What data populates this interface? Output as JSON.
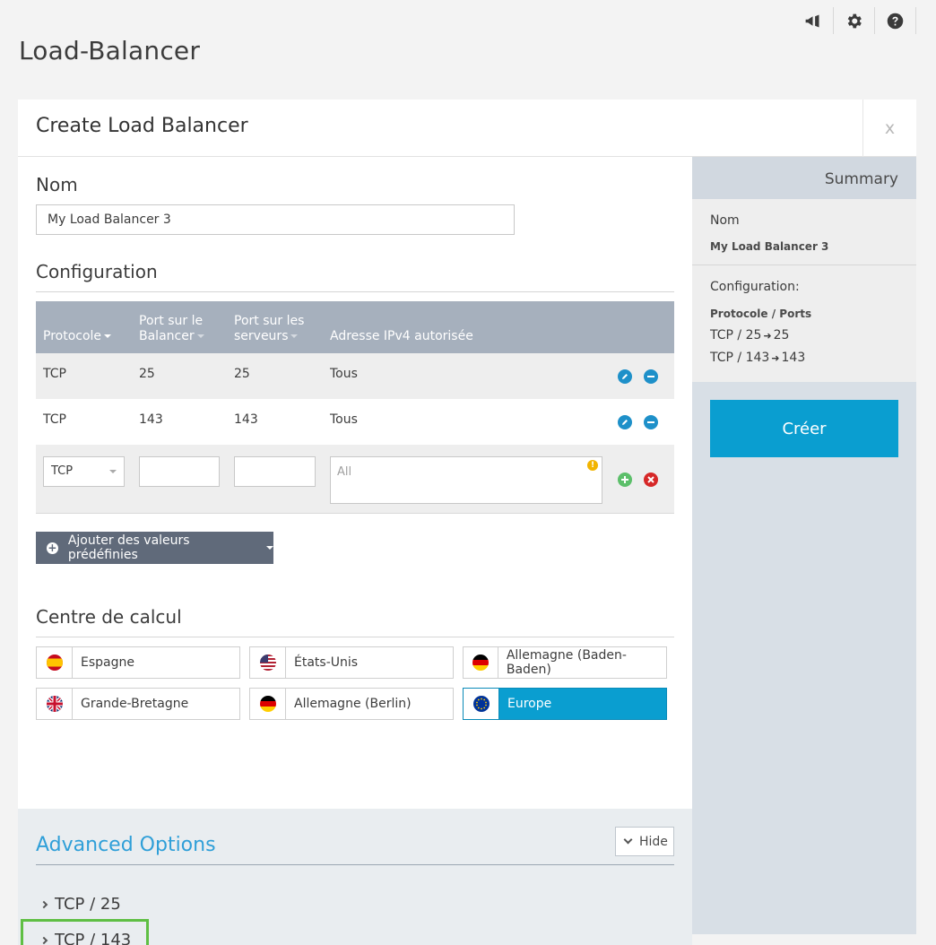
{
  "page": {
    "title": "Load-Balancer"
  },
  "dialog": {
    "title": "Create Load Balancer",
    "close_label": "x"
  },
  "nom": {
    "heading": "Nom",
    "value": "My Load Balancer 3"
  },
  "configuration": {
    "heading": "Configuration",
    "headers": {
      "protocol": "Protocole",
      "balancer_port_1": "Port sur le",
      "balancer_port_2": "Balancer",
      "server_port_1": "Port sur les",
      "server_port_2": "serveurs",
      "ip": "Adresse IPv4 autorisée"
    },
    "rows": [
      {
        "protocol": "TCP",
        "balancer_port": "25",
        "server_port": "25",
        "ip": "Tous"
      },
      {
        "protocol": "TCP",
        "balancer_port": "143",
        "server_port": "143",
        "ip": "Tous"
      }
    ],
    "new_row": {
      "protocol": "TCP",
      "ip_placeholder": "All"
    },
    "predef_label": "Ajouter des valeurs prédéfinies"
  },
  "datacenter": {
    "heading": "Centre de calcul",
    "options": [
      {
        "label": "Espagne",
        "flag": "es",
        "active": false
      },
      {
        "label": "États-Unis",
        "flag": "us",
        "active": false
      },
      {
        "label": "Allemagne (Baden-Baden)",
        "flag": "de",
        "active": false
      },
      {
        "label": "Grande-Bretagne",
        "flag": "gb",
        "active": false
      },
      {
        "label": "Allemagne (Berlin)",
        "flag": "de",
        "active": false
      },
      {
        "label": "Europe",
        "flag": "eu",
        "active": true
      }
    ]
  },
  "advanced": {
    "title": "Advanced Options",
    "hide_label": "Hide",
    "items": [
      "TCP / 25",
      "TCP / 143"
    ]
  },
  "summary": {
    "heading": "Summary",
    "nom_label": "Nom",
    "nom_value": "My Load Balancer 3",
    "config_label": "Configuration:",
    "ports_label": "Protocole / Ports",
    "lines": [
      {
        "left": "TCP / 25",
        "right": "25"
      },
      {
        "left": "TCP / 143",
        "right": "143"
      }
    ],
    "create_label": "Créer"
  },
  "colors": {
    "accent": "#0a9ed0",
    "link": "#2f9fd8",
    "table_header": "#a6b0bd",
    "predef_button": "#606a7a",
    "highlight": "#5fbf44"
  },
  "icons": {
    "topbar": [
      "megaphone-icon",
      "gear-icon",
      "help-icon"
    ]
  }
}
